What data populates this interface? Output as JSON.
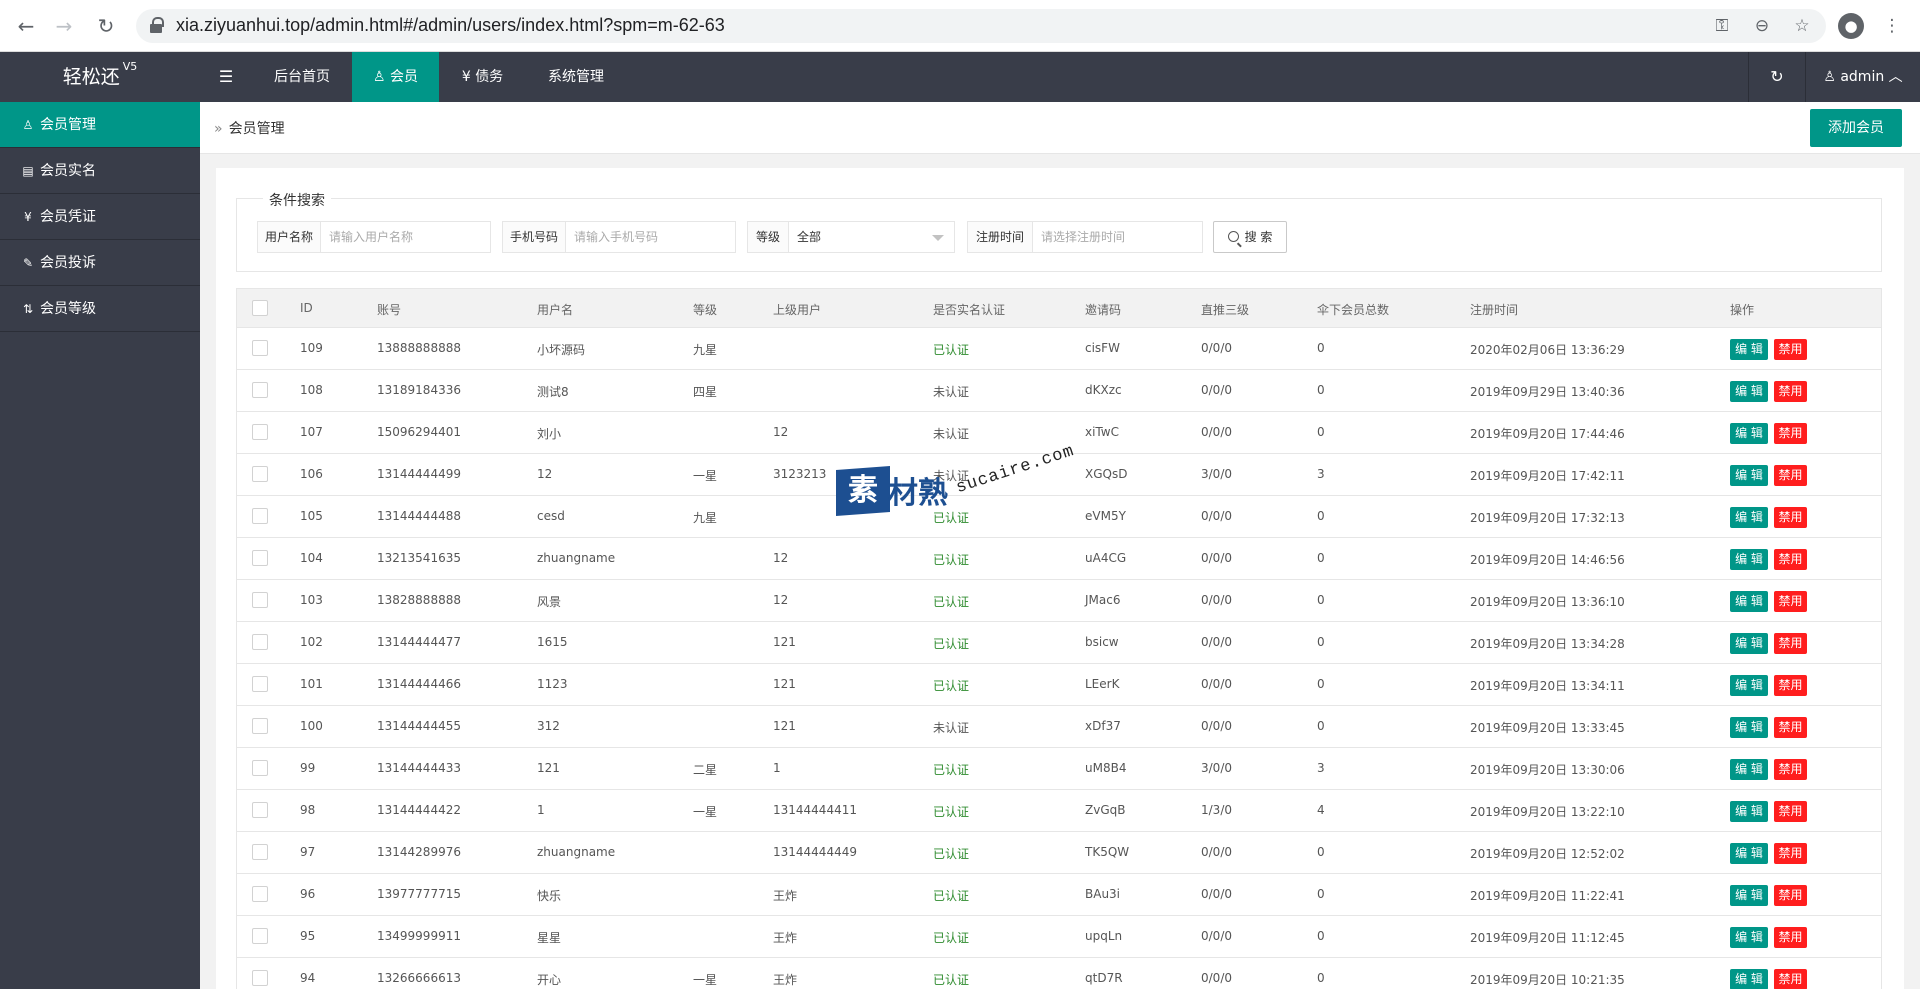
{
  "browser": {
    "url": "xia.ziyuanhui.top/admin.html#/admin/users/index.html?spm=m-62-63"
  },
  "brand": {
    "name": "轻松还",
    "version": "V5"
  },
  "sidebar": {
    "items": [
      {
        "label": "会员管理",
        "icon": "user-icon",
        "glyph": "♙"
      },
      {
        "label": "会员实名",
        "icon": "id-card-icon",
        "glyph": "▤"
      },
      {
        "label": "会员凭证",
        "icon": "yen-circle-icon",
        "glyph": "¥"
      },
      {
        "label": "会员投诉",
        "icon": "complaint-icon",
        "glyph": "✎"
      },
      {
        "label": "会员等级",
        "icon": "sort-icon",
        "glyph": "⇅"
      }
    ]
  },
  "topnav": {
    "items": [
      {
        "label": "后台首页"
      },
      {
        "label": "会员",
        "glyph": "♙"
      },
      {
        "label": "债务",
        "glyph": "¥"
      },
      {
        "label": "系统管理"
      }
    ],
    "user": "admin"
  },
  "breadcrumb": {
    "current": "会员管理"
  },
  "add_button": "添加会员",
  "search": {
    "legend": "条件搜索",
    "username_label": "用户名称",
    "username_placeholder": "请输入用户名称",
    "phone_label": "手机号码",
    "phone_placeholder": "请输入手机号码",
    "level_label": "等级",
    "level_value": "全部",
    "regtime_label": "注册时间",
    "regtime_placeholder": "请选择注册时间",
    "search_button": "搜 索"
  },
  "table": {
    "headers": [
      "ID",
      "账号",
      "用户名",
      "等级",
      "上级用户",
      "是否实名认证",
      "邀请码",
      "直推三级",
      "伞下会员总数",
      "注册时间",
      "操作"
    ],
    "edit_label": "编 辑",
    "ban_label": "禁用",
    "rows": [
      {
        "id": "109",
        "account": "13888888888",
        "name": "小坏源码",
        "level": "九星",
        "parent": "",
        "verified": "已认证",
        "invite": "cisFW",
        "direct": "0/0/0",
        "total": "0",
        "regtime": "2020年02月06日 13:36:29"
      },
      {
        "id": "108",
        "account": "13189184336",
        "name": "测试8",
        "level": "四星",
        "parent": "",
        "verified": "未认证",
        "invite": "dKXzc",
        "direct": "0/0/0",
        "total": "0",
        "regtime": "2019年09月29日 13:40:36"
      },
      {
        "id": "107",
        "account": "15096294401",
        "name": "刘小",
        "level": "",
        "parent": "12",
        "verified": "未认证",
        "invite": "xiTwC",
        "direct": "0/0/0",
        "total": "0",
        "regtime": "2019年09月20日 17:44:46"
      },
      {
        "id": "106",
        "account": "13144444499",
        "name": "12",
        "level": "一星",
        "parent": "3123213",
        "verified": "未认证",
        "invite": "XGQsD",
        "direct": "3/0/0",
        "total": "3",
        "regtime": "2019年09月20日 17:42:11"
      },
      {
        "id": "105",
        "account": "13144444488",
        "name": "cesd",
        "level": "九星",
        "parent": "",
        "verified": "已认证",
        "invite": "eVM5Y",
        "direct": "0/0/0",
        "total": "0",
        "regtime": "2019年09月20日 17:32:13"
      },
      {
        "id": "104",
        "account": "13213541635",
        "name": "zhuangname",
        "level": "",
        "parent": "12",
        "verified": "已认证",
        "invite": "uA4CG",
        "direct": "0/0/0",
        "total": "0",
        "regtime": "2019年09月20日 14:46:56"
      },
      {
        "id": "103",
        "account": "13828888888",
        "name": "风景",
        "level": "",
        "parent": "12",
        "verified": "已认证",
        "invite": "JMac6",
        "direct": "0/0/0",
        "total": "0",
        "regtime": "2019年09月20日 13:36:10"
      },
      {
        "id": "102",
        "account": "13144444477",
        "name": "1615",
        "level": "",
        "parent": "121",
        "verified": "已认证",
        "invite": "bsicw",
        "direct": "0/0/0",
        "total": "0",
        "regtime": "2019年09月20日 13:34:28"
      },
      {
        "id": "101",
        "account": "13144444466",
        "name": "1123",
        "level": "",
        "parent": "121",
        "verified": "已认证",
        "invite": "LEerK",
        "direct": "0/0/0",
        "total": "0",
        "regtime": "2019年09月20日 13:34:11"
      },
      {
        "id": "100",
        "account": "13144444455",
        "name": "312",
        "level": "",
        "parent": "121",
        "verified": "未认证",
        "invite": "xDf37",
        "direct": "0/0/0",
        "total": "0",
        "regtime": "2019年09月20日 13:33:45"
      },
      {
        "id": "99",
        "account": "13144444433",
        "name": "121",
        "level": "二星",
        "parent": "1",
        "verified": "已认证",
        "invite": "uM8B4",
        "direct": "3/0/0",
        "total": "3",
        "regtime": "2019年09月20日 13:30:06"
      },
      {
        "id": "98",
        "account": "13144444422",
        "name": "1",
        "level": "一星",
        "parent": "13144444411",
        "verified": "已认证",
        "invite": "ZvGqB",
        "direct": "1/3/0",
        "total": "4",
        "regtime": "2019年09月20日 13:22:10"
      },
      {
        "id": "97",
        "account": "13144289976",
        "name": "zhuangname",
        "level": "",
        "parent": "13144444449",
        "verified": "已认证",
        "invite": "TK5QW",
        "direct": "0/0/0",
        "total": "0",
        "regtime": "2019年09月20日 12:52:02"
      },
      {
        "id": "96",
        "account": "13977777715",
        "name": "快乐",
        "level": "",
        "parent": "王炸",
        "verified": "已认证",
        "invite": "BAu3i",
        "direct": "0/0/0",
        "total": "0",
        "regtime": "2019年09月20日 11:22:41"
      },
      {
        "id": "95",
        "account": "13499999911",
        "name": "星星",
        "level": "",
        "parent": "王炸",
        "verified": "已认证",
        "invite": "upqLn",
        "direct": "0/0/0",
        "total": "0",
        "regtime": "2019年09月20日 11:12:45"
      },
      {
        "id": "94",
        "account": "13266666613",
        "name": "开心",
        "level": "一星",
        "parent": "王炸",
        "verified": "已认证",
        "invite": "qtD7R",
        "direct": "0/0/0",
        "total": "0",
        "regtime": "2019年09月20日 10:21:35"
      }
    ]
  },
  "watermark": {
    "mark": "素",
    "text": "材熟",
    "url": "sucaire.com"
  },
  "colors": {
    "accent": "#009688",
    "danger": "#ff1e1e",
    "dark": "#393d49",
    "verified": "#2e8b2e"
  }
}
